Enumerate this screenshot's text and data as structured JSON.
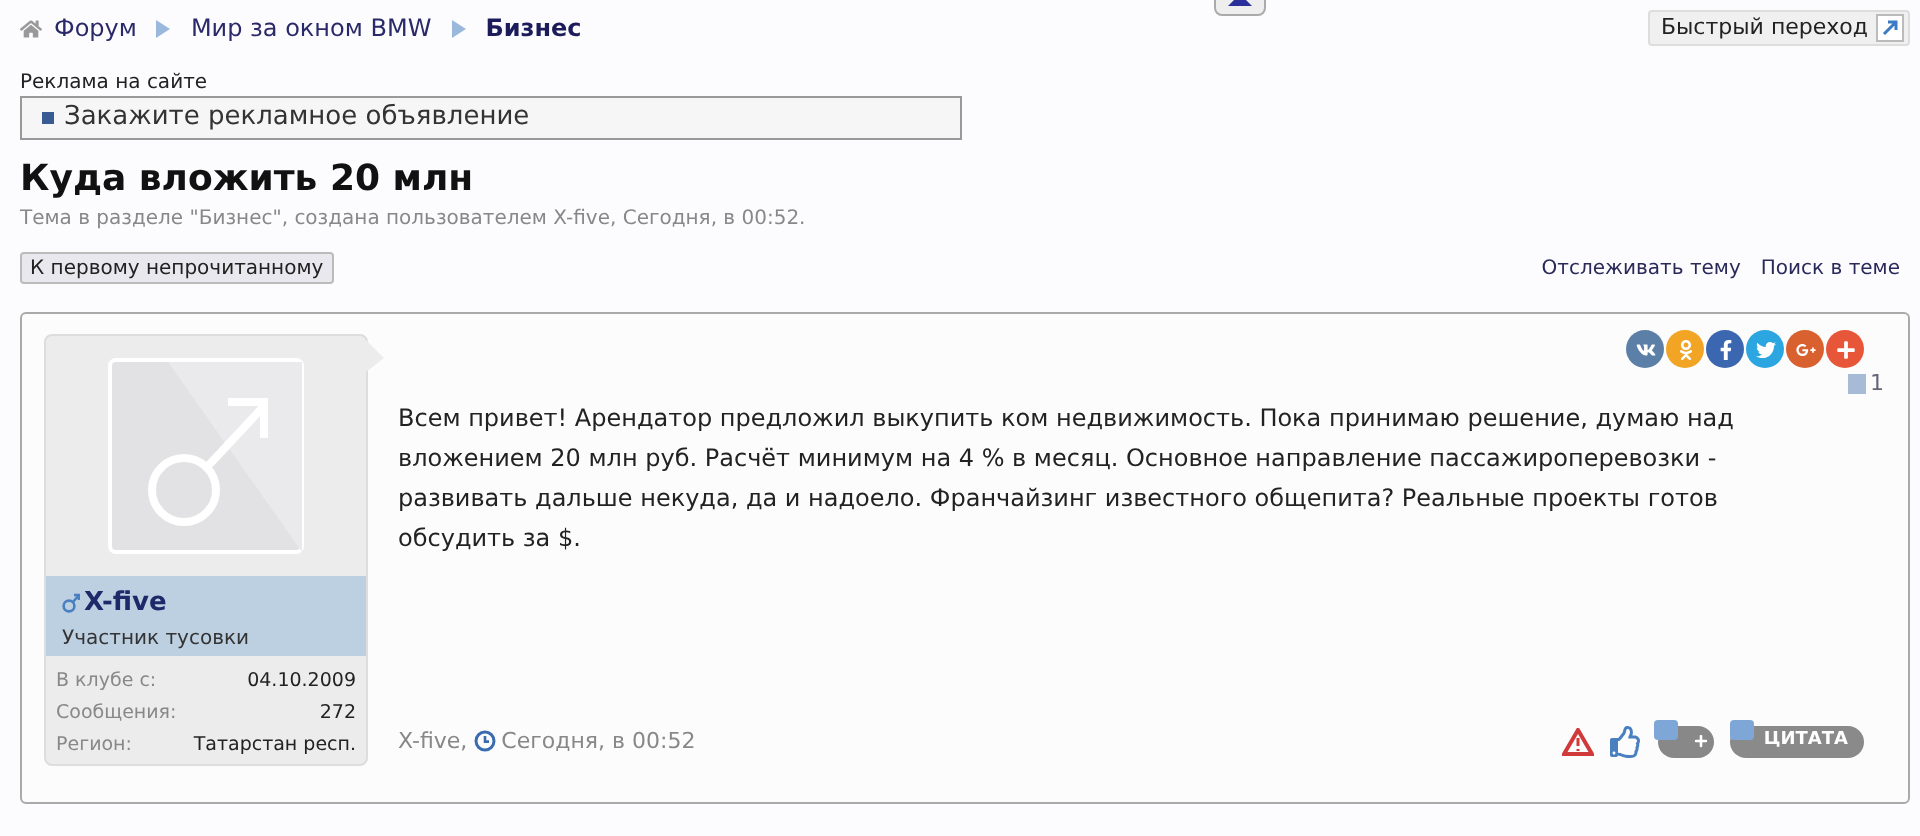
{
  "breadcrumb": [
    {
      "label": "Форум",
      "current": false
    },
    {
      "label": "Мир за окном BMW",
      "current": false
    },
    {
      "label": "Бизнес",
      "current": true
    }
  ],
  "quick_nav": {
    "label": "Быстрый переход"
  },
  "ad": {
    "heading": "Реклама на сайте",
    "link": "Закажите рекламное объявление"
  },
  "thread": {
    "title": "Куда вложить 20 млн",
    "meta": "Тема в разделе \"Бизнес\", создана пользователем X-five, Сегодня, в 00:52.",
    "first_unread": "К первому непрочитанному",
    "links": [
      "Отслеживать тему",
      "Поиск в теме"
    ]
  },
  "post": {
    "author": {
      "name": "X-five",
      "title": "Участник тусовки",
      "stats": [
        {
          "label": "В клубе с:",
          "value": "04.10.2009"
        },
        {
          "label": "Сообщения:",
          "value": "272"
        },
        {
          "label": "Регион:",
          "value": "Татарстан респ."
        }
      ]
    },
    "share": [
      {
        "kind": "vk",
        "color": "#5b7fa6"
      },
      {
        "kind": "ok",
        "color": "#f2a425"
      },
      {
        "kind": "facebook",
        "color": "#3b66b0"
      },
      {
        "kind": "twitter",
        "color": "#2ba6e1"
      },
      {
        "kind": "gplus",
        "color": "#d9612f"
      },
      {
        "kind": "more",
        "color": "#e8563a"
      }
    ],
    "number": "1",
    "text": "Всем привет! Арендатор предложил выкупить ком недвижимость. Пока принимаю решение, думаю над вложением 20 млн руб. Расчёт минимум на 4 % в месяц. Основное направление пассажироперевозки - развивать дальше некуда, да и надоело. Франчайзинг известного общепита? Реальные проекты готов обсудить за $.",
    "footer_author": "X-five,",
    "footer_time": "Сегодня, в 00:52",
    "quote_label": "ЦИТАТА"
  }
}
